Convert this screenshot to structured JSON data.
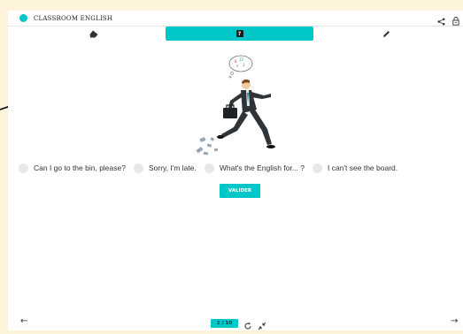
{
  "colors": {
    "accent": "#00c8c8",
    "background": "#fdf3da",
    "panel": "#ffffff",
    "pager_text": "#0d3940"
  },
  "header": {
    "title": "CLASSROOM ENGLISH",
    "icons": [
      "share-icon",
      "lock-icon"
    ]
  },
  "tabs": [
    {
      "icon": "eraser-icon",
      "active": false
    },
    {
      "icon": "question-icon",
      "label": "?",
      "active": true
    },
    {
      "icon": "pencil-icon",
      "active": false
    }
  ],
  "choices": [
    "Can I go to the bin, please?",
    "Sorry, I'm late.",
    "What's the English for... ?",
    "I can't see the board."
  ],
  "submit_label": "VALIDER",
  "footer": {
    "page_indicator": "1 / 10",
    "prev_icon": "arrow-left-icon",
    "next_icon": "arrow-right-icon",
    "controls": [
      "refresh-icon",
      "shrink-icon"
    ]
  }
}
